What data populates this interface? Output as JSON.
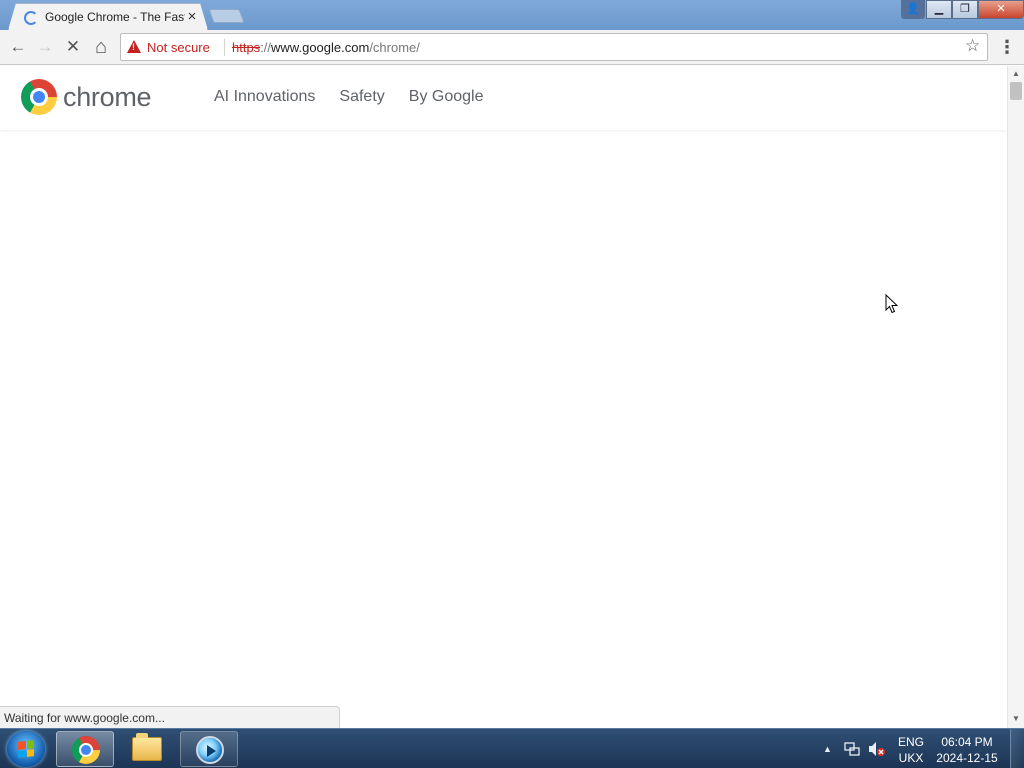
{
  "browser": {
    "tab": {
      "title": "Google Chrome - The Fast & Secure Web Browser Built to be Yours",
      "close_glyph": "×"
    },
    "window": {
      "minimize_glyph": "▁",
      "restore_glyph": "❐",
      "close_glyph": "✕",
      "user_glyph": "👤"
    },
    "toolbar": {
      "back_glyph": "←",
      "forward_glyph": "→",
      "stop_glyph": "✕",
      "home_glyph": "⌂",
      "menu_glyph": "⋮"
    },
    "omnibox": {
      "security_label": "Not secure",
      "url_scheme": "https",
      "url_sep": "://",
      "url_host": "www.google.com",
      "url_path": "/chrome/",
      "bookmark_glyph": "☆"
    },
    "status_text": "Waiting for www.google.com..."
  },
  "page": {
    "brand": "chrome",
    "nav": [
      {
        "label": "AI Innovations"
      },
      {
        "label": "Safety"
      },
      {
        "label": "By Google"
      }
    ]
  },
  "scrollbar": {
    "up_glyph": "▲",
    "down_glyph": "▼"
  },
  "taskbar": {
    "apps": [
      {
        "name": "Google Chrome",
        "icon": "chrome-icon",
        "state": "active"
      },
      {
        "name": "Windows Explorer",
        "icon": "folder-icon",
        "state": "pinned"
      },
      {
        "name": "Windows Media Player",
        "icon": "media-player-icon",
        "state": "open"
      }
    ],
    "tray": {
      "overflow_glyph": "▲",
      "language": "ENG",
      "layout": "UKX",
      "time": "06:04 PM",
      "date": "2024-12-15"
    }
  },
  "colors": {
    "insecure_red": "#c5221f",
    "nav_text": "#5f6368",
    "chrome_red": "#db4437",
    "chrome_yellow": "#ffcd40",
    "chrome_green": "#0f9d58",
    "chrome_blue": "#4285f4"
  }
}
